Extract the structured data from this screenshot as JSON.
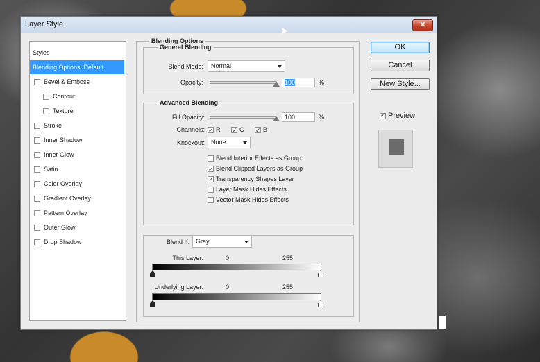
{
  "dialog": {
    "title": "Layer Style",
    "close_glyph": "✕"
  },
  "styles_panel": {
    "header": "Styles",
    "items": [
      {
        "label": "Blending Options: Default",
        "selected": true,
        "checkbox": false
      },
      {
        "label": "Bevel & Emboss",
        "checkbox": true,
        "checked": false
      },
      {
        "label": "Contour",
        "checkbox": true,
        "checked": false,
        "indent": true
      },
      {
        "label": "Texture",
        "checkbox": true,
        "checked": false,
        "indent": true
      },
      {
        "label": "Stroke",
        "checkbox": true,
        "checked": false
      },
      {
        "label": "Inner Shadow",
        "checkbox": true,
        "checked": false
      },
      {
        "label": "Inner Glow",
        "checkbox": true,
        "checked": false
      },
      {
        "label": "Satin",
        "checkbox": true,
        "checked": false
      },
      {
        "label": "Color Overlay",
        "checkbox": true,
        "checked": false
      },
      {
        "label": "Gradient Overlay",
        "checkbox": true,
        "checked": false
      },
      {
        "label": "Pattern Overlay",
        "checkbox": true,
        "checked": false
      },
      {
        "label": "Outer Glow",
        "checkbox": true,
        "checked": false
      },
      {
        "label": "Drop Shadow",
        "checkbox": true,
        "checked": false
      }
    ]
  },
  "blending": {
    "section_title": "Blending Options",
    "general": {
      "title": "General Blending",
      "blend_mode_label": "Blend Mode:",
      "blend_mode_value": "Normal",
      "opacity_label": "Opacity:",
      "opacity_value": "100",
      "opacity_unit": "%",
      "opacity_level": 1.0
    },
    "advanced": {
      "title": "Advanced Blending",
      "fill_opacity_label": "Fill Opacity:",
      "fill_opacity_value": "100",
      "fill_opacity_unit": "%",
      "fill_opacity_level": 1.0,
      "channels_label": "Channels:",
      "channels": [
        {
          "label": "R",
          "checked": true
        },
        {
          "label": "G",
          "checked": true
        },
        {
          "label": "B",
          "checked": true
        }
      ],
      "knockout_label": "Knockout:",
      "knockout_value": "None",
      "options": [
        {
          "label": "Blend Interior Effects as Group",
          "checked": false
        },
        {
          "label": "Blend Clipped Layers as Group",
          "checked": true
        },
        {
          "label": "Transparency Shapes Layer",
          "checked": true
        },
        {
          "label": "Layer Mask Hides Effects",
          "checked": false
        },
        {
          "label": "Vector Mask Hides Effects",
          "checked": false
        }
      ]
    },
    "blend_if": {
      "label": "Blend If:",
      "value": "Gray",
      "this_layer_label": "This Layer:",
      "this_layer_min": "0",
      "this_layer_max": "255",
      "underlying_label": "Underlying Layer:",
      "underlying_min": "0",
      "underlying_max": "255"
    }
  },
  "buttons": {
    "ok": "OK",
    "cancel": "Cancel",
    "new_style": "New Style...",
    "preview_label": "Preview",
    "preview_checked": true
  },
  "colors": {
    "selection": "#3399ff",
    "preview_swatch": "#6b6b6b"
  }
}
